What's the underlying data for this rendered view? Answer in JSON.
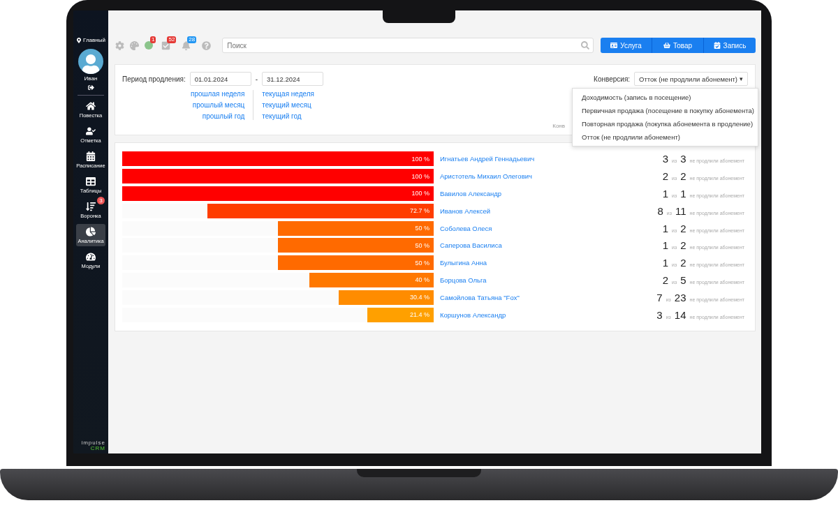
{
  "sidebar": {
    "location": "Главный",
    "user": "Иван",
    "items": [
      {
        "kind": "home",
        "label": "Повестка",
        "selected": false
      },
      {
        "kind": "check",
        "label": "Отметка",
        "selected": false
      },
      {
        "kind": "calendar",
        "label": "Расписание",
        "selected": false
      },
      {
        "kind": "table",
        "label": "Таблицы",
        "selected": false
      },
      {
        "kind": "funnel",
        "label": "Воронка",
        "badge": "3",
        "selected": false
      },
      {
        "kind": "pie",
        "label": "Аналитика",
        "selected": true
      },
      {
        "kind": "gauge",
        "label": "Модули",
        "selected": false
      }
    ],
    "brand": [
      "impulse",
      "CRM"
    ]
  },
  "toolbar": {
    "icons": [
      {
        "kind": "gear"
      },
      {
        "kind": "palette"
      },
      {
        "kind": "dot",
        "badge": "1",
        "color": "#e53935"
      },
      {
        "kind": "tasks",
        "badge": "52",
        "color": "#e53935"
      },
      {
        "kind": "bell",
        "badge": "28",
        "color": "#2196f3"
      },
      {
        "kind": "help"
      }
    ],
    "search": {
      "placeholder": "Поиск"
    },
    "buttons": [
      {
        "kind": "service",
        "label": "Услуга"
      },
      {
        "kind": "product",
        "label": "Товар"
      },
      {
        "kind": "booking",
        "label": "Запись"
      }
    ]
  },
  "filter": {
    "period_label": "Период продления:",
    "date_from": "01.01.2024",
    "separator": "-",
    "date_to": "31.12.2024",
    "quick_links": [
      [
        "прошлая неделя",
        "прошлый месяц",
        "прошлый год"
      ],
      [
        "текущая неделя",
        "текущий месяц",
        "текущий год"
      ]
    ],
    "conversion_label": "Конверсия:",
    "conversion_value": "Отток (не продлили абонемент)",
    "conversion_caret": "▾",
    "note": "Конв",
    "menu": [
      "Доходимость (запись в посещение)",
      "Первичная продажа (посещение в покупку абонемента)",
      "Повторная продажа (покупка абонемента в продление)",
      "Отток (не продлили абонемент)"
    ]
  },
  "rows": [
    {
      "name": "Игнатьев Андрей Геннадьевич",
      "level": 1,
      "percent": "100 %",
      "color": "#ff0000",
      "count": "3",
      "of": "из",
      "total": "3",
      "note": "не продлили абонемент"
    },
    {
      "name": "Аристотель Михаил Олегович",
      "level": 1,
      "percent": "100 %",
      "color": "#ff0000",
      "count": "2",
      "of": "из",
      "total": "2",
      "note": "не продлили абонемент"
    },
    {
      "name": "Вавилов Александр",
      "level": 1,
      "percent": "100 %",
      "color": "#ff0000",
      "count": "1",
      "of": "из",
      "total": "1",
      "note": "не продлили абонемент"
    },
    {
      "name": "Иванов Алексей",
      "level": 0.727,
      "percent": "72.7 %",
      "color": "#ff3d00",
      "count": "8",
      "of": "из",
      "total": "11",
      "note": "не продлили абонемент"
    },
    {
      "name": "Соболева Олеся",
      "level": 0.5,
      "percent": "50 %",
      "color": "#ff6a00",
      "count": "1",
      "of": "из",
      "total": "2",
      "note": "не продлили абонемент"
    },
    {
      "name": "Саперова Василиса",
      "level": 0.5,
      "percent": "50 %",
      "color": "#ff6a00",
      "count": "1",
      "of": "из",
      "total": "2",
      "note": "не продлили абонемент"
    },
    {
      "name": "Булыгина Анна",
      "level": 0.5,
      "percent": "50 %",
      "color": "#ff6a00",
      "count": "1",
      "of": "из",
      "total": "2",
      "note": "не продлили абонемент"
    },
    {
      "name": "Борцова Ольга",
      "level": 0.4,
      "percent": "40 %",
      "color": "#ff7800",
      "count": "2",
      "of": "из",
      "total": "5",
      "note": "не продлили абонемент"
    },
    {
      "name": "Самойлова Татьяна \"Fox\"",
      "level": 0.304,
      "percent": "30.4 %",
      "color": "#ff8c00",
      "count": "7",
      "of": "из",
      "total": "23",
      "note": "не продлили абонемент"
    },
    {
      "name": "Коршунов Александр",
      "level": 0.214,
      "percent": "21.4 %",
      "color": "#ffa000",
      "count": "3",
      "of": "из",
      "total": "14",
      "note": "не продлили абонемент"
    }
  ]
}
